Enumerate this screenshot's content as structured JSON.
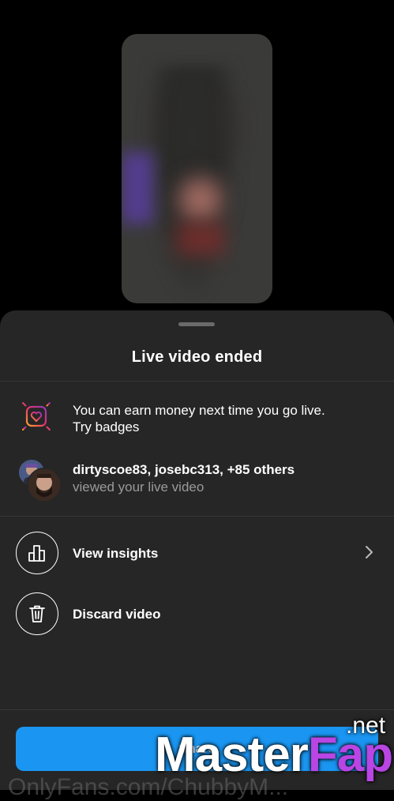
{
  "sheet": {
    "title": "Live video ended",
    "badges_line1": "You can earn money next time you go live.",
    "badges_line2": "Try badges",
    "viewers_names": "dirtyscoe83, josebc313, +85 others",
    "viewers_sub": "viewed your live video",
    "view_insights": "View insights",
    "discard_video": "Discard video",
    "share_button": "Share"
  },
  "watermark": {
    "part1": "Master",
    "part2": "Fap",
    "suffix": ".net",
    "bottom_text": "OnlyFans.com/ChubbyM..."
  },
  "colors": {
    "sheet_bg": "#262626",
    "accent_blue": "#1a96f2",
    "badge_gradient": [
      "#f58529",
      "#dd2a7b",
      "#8134af"
    ]
  },
  "icons": {
    "badge": "heart-badge-icon",
    "insights": "bar-chart-icon",
    "discard": "trash-icon",
    "chevron": "chevron-right-icon"
  }
}
